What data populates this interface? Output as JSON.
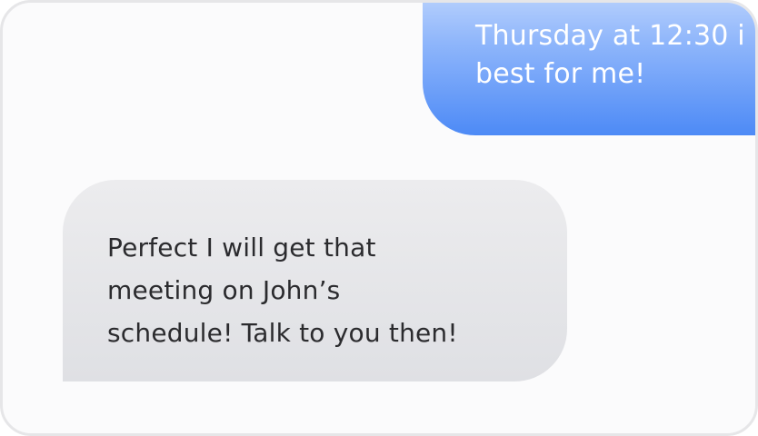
{
  "conversation": {
    "sent_message": {
      "lines": [
        "Thursday at 12:30 i",
        "best for me!"
      ]
    },
    "received_message": {
      "lines": [
        "Perfect I will get that",
        "meeting on John’s",
        "schedule! Talk to you then!"
      ]
    }
  },
  "colors": {
    "sent_bubble_top": "#cfe0fd",
    "sent_bubble_bottom": "#4d8af6",
    "received_bubble": "#e6e7ea",
    "received_text": "#2b2b2e",
    "frame_border": "#e6e6e8"
  }
}
